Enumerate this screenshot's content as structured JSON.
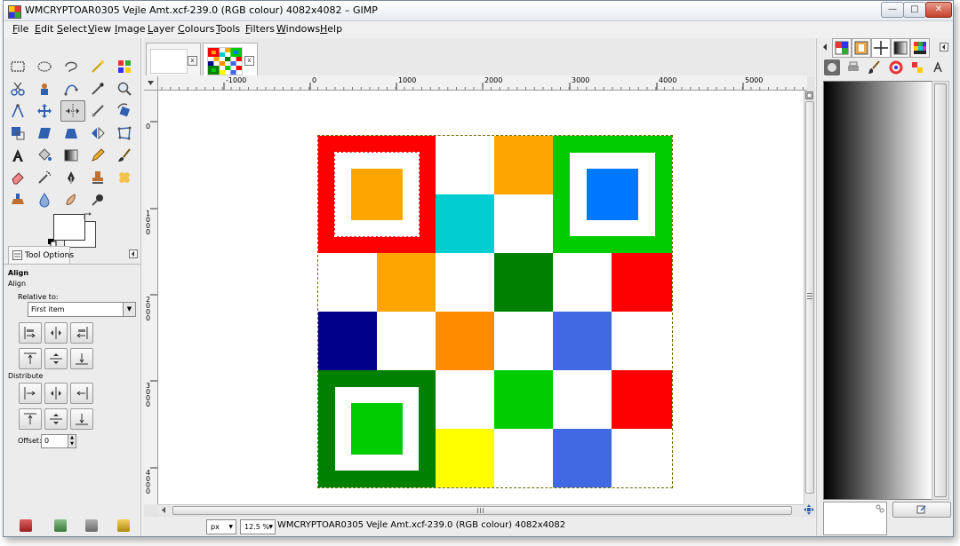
{
  "window": {
    "title": "WMCRYPTOAR0305 Vejle Amt.xcf-239.0 (RGB colour) 4082x4082 – GIMP",
    "min_label": "—",
    "max_label": "□",
    "close_label": "✕"
  },
  "menu": [
    "File",
    "Edit",
    "Select",
    "View",
    "Image",
    "Layer",
    "Colours",
    "Tools",
    "Filters",
    "Windows",
    "Help"
  ],
  "tool_options": {
    "tab_label": "Tool Options",
    "heading": "Align",
    "subheading": "Align",
    "relative_to_label": "Relative to:",
    "relative_to_value": "First item",
    "distribute_label": "Distribute",
    "offset_label": "Offset:",
    "offset_value": "0"
  },
  "tabs": {
    "close_label": "x"
  },
  "rulers": {
    "h_labels": [
      "-1000",
      "0",
      "1000",
      "2000",
      "3000",
      "4000",
      "5000"
    ],
    "v_labels": [
      "0",
      "1000",
      "2000",
      "3000",
      "4000"
    ]
  },
  "status": {
    "unit": "px",
    "zoom": "12.5 %",
    "text": "WMCRYPTOAR0305 Vejle Amt.xcf-239.0 (RGB colour) 4082x4082"
  },
  "colors": {
    "red": "#ff0000",
    "orange": "#ffa500",
    "dark_orange": "#ff8c00",
    "green": "#00cc00",
    "dark_green": "#008000",
    "cyan": "#00ced1",
    "blue": "#0077ff",
    "navy": "#00008b",
    "royal_blue": "#4169e1",
    "yellow": "#ffff00",
    "white": "#ffffff"
  }
}
